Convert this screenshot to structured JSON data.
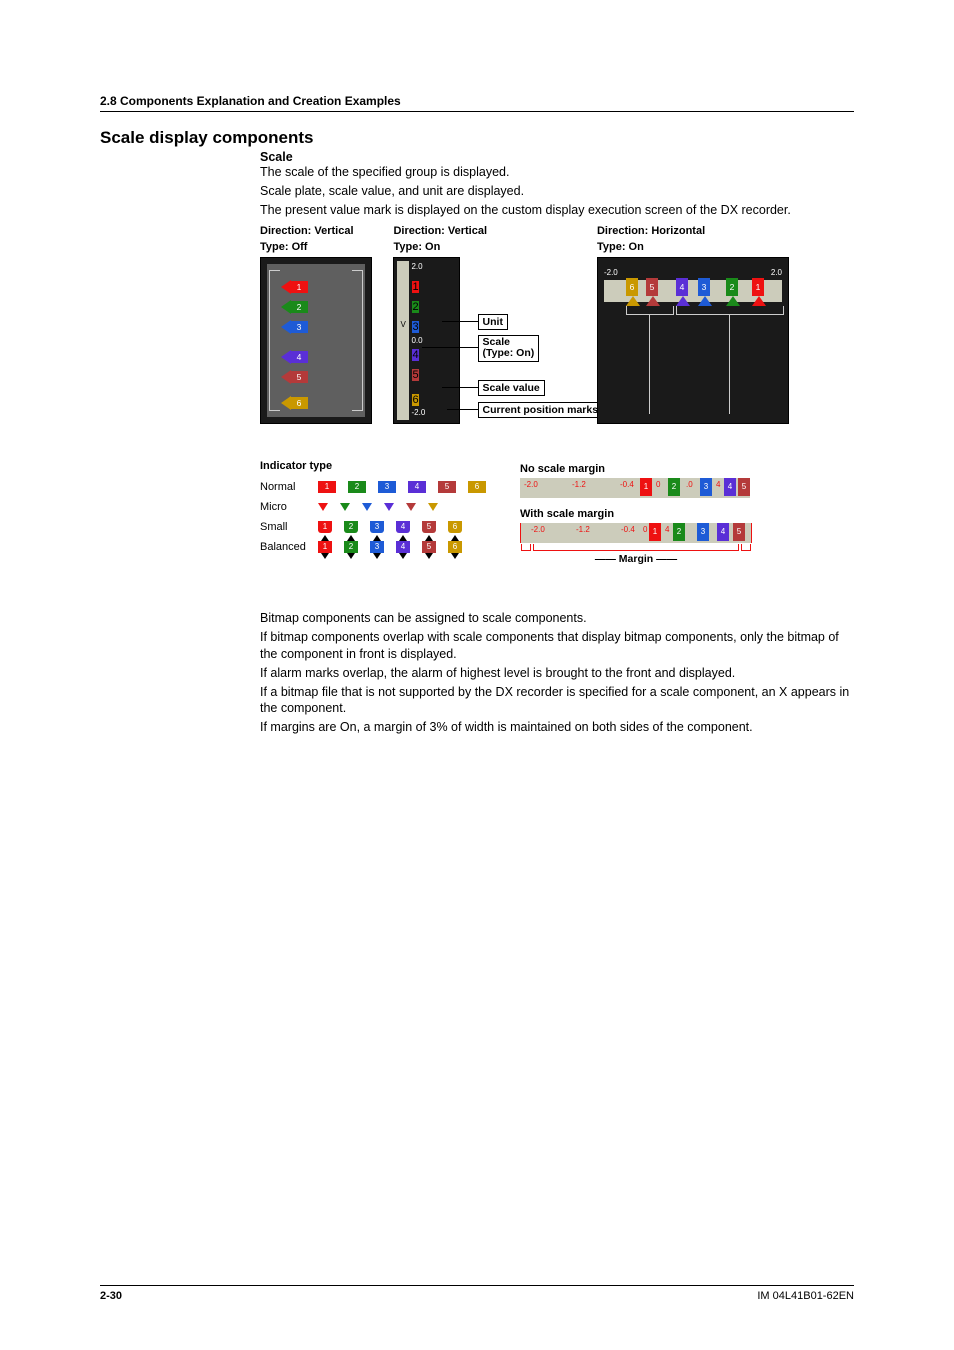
{
  "header": {
    "section": "2.8  Components Explanation and Creation Examples"
  },
  "title": "Scale display components",
  "scale": {
    "heading": "Scale",
    "p1": "The scale of the specified group is displayed.",
    "p2": "Scale plate, scale value, and unit are displayed.",
    "p3": "The present value mark is displayed on the custom display execution screen of the DX recorder."
  },
  "fig": {
    "c1a": "Direction: Vertical",
    "c1b": "Type: Off",
    "c2a": "Direction: Vertical",
    "c2b": "Type: On",
    "c3a": "Direction: Horizontal",
    "c3b": "Type: On",
    "lbUnit": "Unit",
    "lbScale1": "Scale",
    "lbScale2": "(Type: On)",
    "lbVal": "Scale value",
    "lbPos": "Current position marks",
    "n": [
      "1",
      "2",
      "3",
      "4",
      "5",
      "6"
    ],
    "tv": {
      "top": "2.0",
      "mid": "0.0",
      "bot": "-2.0",
      "unit": "V"
    },
    "hv": {
      "l": "-2.0",
      "r": "2.0"
    }
  },
  "ind": {
    "title": "Indicator type",
    "rows": [
      "Normal",
      "Micro",
      "Small",
      "Balanced"
    ],
    "n": [
      "1",
      "2",
      "3",
      "4",
      "5",
      "6"
    ]
  },
  "marg": {
    "t1": "No scale margin",
    "t2": "With scale margin",
    "margin": "Margin",
    "v": {
      "a": "-2.0",
      "b": "-1.2",
      "c": "-0.4",
      "d": "0",
      "e": "2",
      "f": ".0",
      "g": "4",
      "h": "5"
    },
    "w": {
      "a": "-2.0",
      "b": "-1.2",
      "c": "-0.4",
      "d": "0",
      "e": "4",
      "f": "2",
      "g": "3",
      "h": "4",
      "i": "5"
    }
  },
  "body": {
    "p1": "Bitmap components can be assigned to scale components.",
    "p2": "If bitmap components overlap with scale components that display bitmap components, only the bitmap of the component in front is displayed.",
    "p3": "If alarm marks overlap, the alarm of highest level is brought to the front and displayed.",
    "p4": "If a bitmap file that is not supported by the DX recorder is specified for a scale component, an X appears in the component.",
    "p5": "If margins are On, a margin of 3% of width is maintained on both sides of the component."
  },
  "footer": {
    "page": "2-30",
    "doc": "IM 04L41B01-62EN"
  }
}
